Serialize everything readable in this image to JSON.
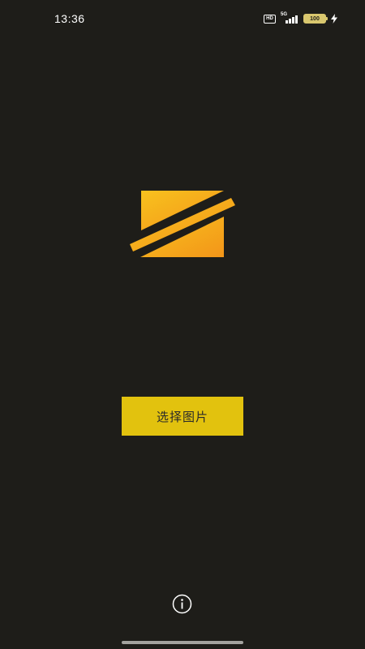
{
  "status_bar": {
    "time": "13:36",
    "hd_label": "HD",
    "network_label": "5G",
    "battery_level": "100",
    "icons": [
      "hd-icon",
      "signal-5g-icon",
      "battery-icon",
      "charging-bolt-icon"
    ]
  },
  "main": {
    "logo_icon": "app-logo-icon",
    "pick_image_button_label": "选择图片",
    "info_icon": "info-icon"
  },
  "colors": {
    "background": "#1e1d19",
    "button": "#e2c20e",
    "logo_gradient_start": "#f6b91c",
    "logo_gradient_end": "#f49a1a"
  }
}
